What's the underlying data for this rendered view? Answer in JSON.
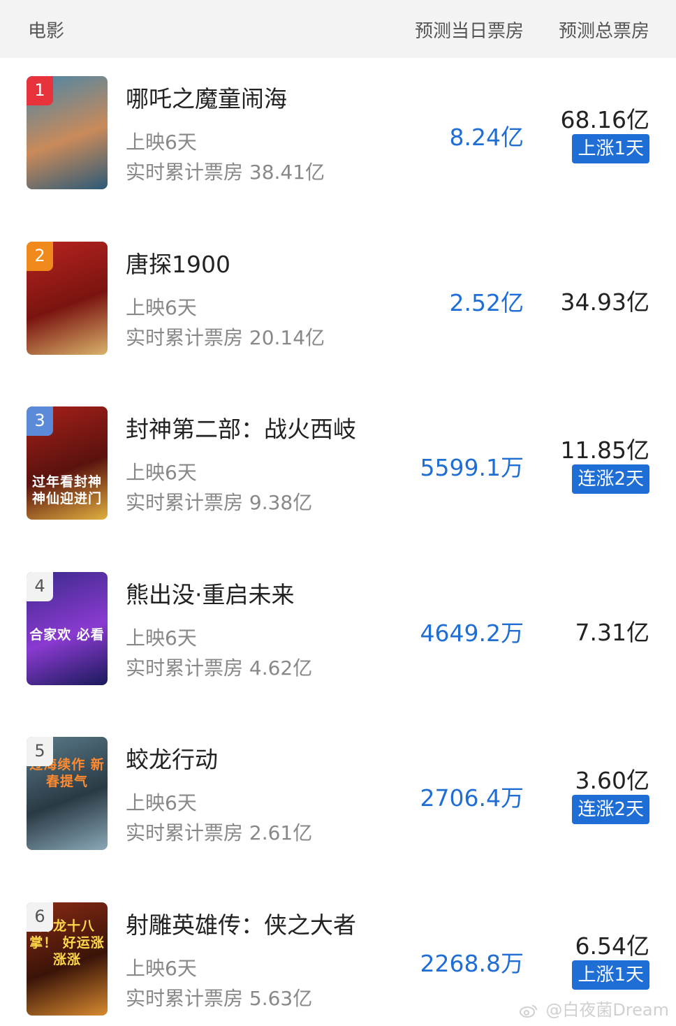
{
  "header": {
    "title": "电影",
    "col_daily": "预测当日票房",
    "col_total": "预测总票房"
  },
  "movies": [
    {
      "rank": "1",
      "title": "哪吒之魔童闹海",
      "days": "上映6天",
      "cumulative": "实时累计票房 38.41亿",
      "daily": "8.24亿",
      "total": "68.16亿",
      "badge": "上涨1天",
      "poster_colors": [
        "#4a86a8",
        "#c98a5a",
        "#2c5a78"
      ]
    },
    {
      "rank": "2",
      "title": "唐探1900",
      "days": "上映6天",
      "cumulative": "实时累计票房 20.14亿",
      "daily": "2.52亿",
      "total": "34.93亿",
      "badge": "",
      "poster_colors": [
        "#b8231f",
        "#7a1410",
        "#d9b36a"
      ]
    },
    {
      "rank": "3",
      "title": "封神第二部：战火西岐",
      "days": "上映6天",
      "cumulative": "实时累计票房 9.38亿",
      "daily": "5599.1万",
      "total": "11.85亿",
      "badge": "连涨2天",
      "poster_colors": [
        "#a8201a",
        "#5a120e",
        "#e0b040"
      ],
      "poster_caption": "过年看封神 神仙迎进门"
    },
    {
      "rank": "4",
      "title": "熊出没·重启未来",
      "days": "上映6天",
      "cumulative": "实时累计票房 4.62亿",
      "daily": "4649.2万",
      "total": "7.31亿",
      "badge": "",
      "poster_colors": [
        "#3a2a8a",
        "#8a3ad0",
        "#1a1a5a"
      ],
      "poster_caption": "合家欢 必看"
    },
    {
      "rank": "5",
      "title": "蛟龙行动",
      "days": "上映6天",
      "cumulative": "实时累计票房 2.61亿",
      "daily": "2706.4万",
      "total": "3.60亿",
      "badge": "连涨2天",
      "poster_colors": [
        "#5a7a8a",
        "#2a3a44",
        "#8aa8b8"
      ],
      "poster_caption": "过海续作 新春提气"
    },
    {
      "rank": "6",
      "title": "射雕英雄传：侠之大者",
      "days": "上映6天",
      "cumulative": "实时累计票房 5.63亿",
      "daily": "2268.8万",
      "total": "6.54亿",
      "badge": "上涨1天",
      "poster_colors": [
        "#8a2a14",
        "#3a1408",
        "#d88a30"
      ],
      "poster_caption": "降龙十八掌！ 好运涨涨涨"
    }
  ],
  "watermark": "@白夜菌Dream"
}
